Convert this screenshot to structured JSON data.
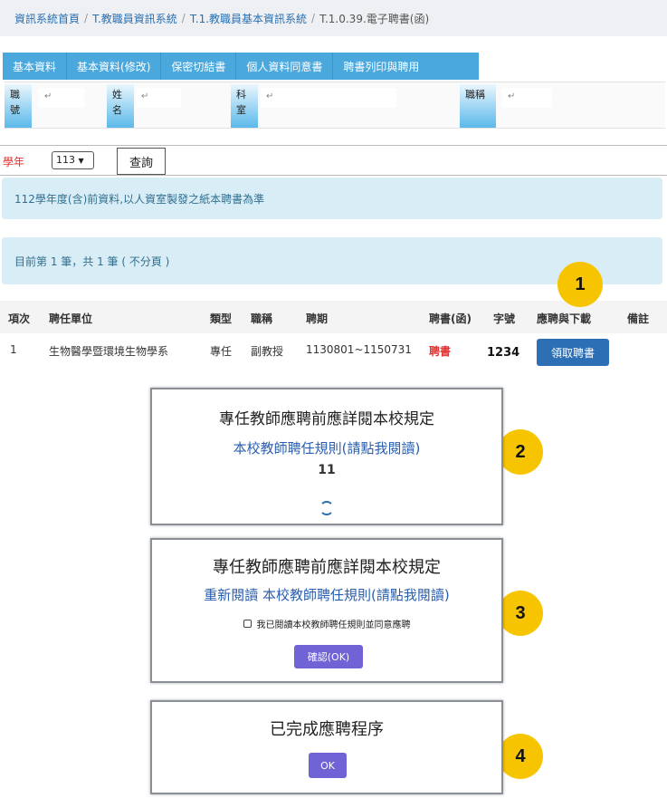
{
  "breadcrumb": {
    "items": [
      "資訊系統首頁",
      "T.教職員資訊系統",
      "T.1.教職員基本資訊系統"
    ],
    "current": "T.1.0.39.電子聘書(函)"
  },
  "tabs": [
    "基本資料",
    "基本資料(修改)",
    "保密切結書",
    "個人資料同意書",
    "聘書列印與聘用"
  ],
  "info": {
    "labels": [
      "職號",
      "姓名",
      "科室",
      "職稱"
    ],
    "placeholder": "↵"
  },
  "query": {
    "label": "學年",
    "year": "113",
    "button": "查詢"
  },
  "notice_1": "112學年度(含)前資料,以人資室製發之紙本聘書為準",
  "notice_2": "目前第 1 筆，共 1 筆 ( 不分頁 )",
  "table": {
    "headers": [
      "項次",
      "聘任單位",
      "類型",
      "職稱",
      "聘期",
      "聘書(函)",
      "字號",
      "應聘與下載",
      "備註"
    ],
    "row": {
      "index": "1",
      "unit": "生物醫學暨環境生物學系",
      "type": "專任",
      "title": "副教授",
      "period": "1130801~1150731",
      "letter": "聘書",
      "number": "1234",
      "download": "領取聘書",
      "note": ""
    }
  },
  "badges": [
    "1",
    "2",
    "3",
    "4"
  ],
  "dialog_2": {
    "title": "專任教師應聘前應詳閱本校規定",
    "link": "本校教師聘任規則(請點我閱讀)",
    "countdown": "11"
  },
  "dialog_3": {
    "title": "專任教師應聘前應詳閱本校規定",
    "link": "重新閱讀 本校教師聘任規則(請點我閱讀)",
    "agree": "我已閱讀本校教師聘任規則並同意應聘",
    "button": "確認(OK)"
  },
  "dialog_4": {
    "title": "已完成應聘程序",
    "button": "OK"
  },
  "colors": {
    "tab_bar": "#4aa8dd",
    "badge": "#f6c400",
    "primary_button": "#2d6fb4",
    "dialog_button": "#6f63d6",
    "notice_bg": "#d9edf7",
    "alert_red": "#e03030"
  }
}
